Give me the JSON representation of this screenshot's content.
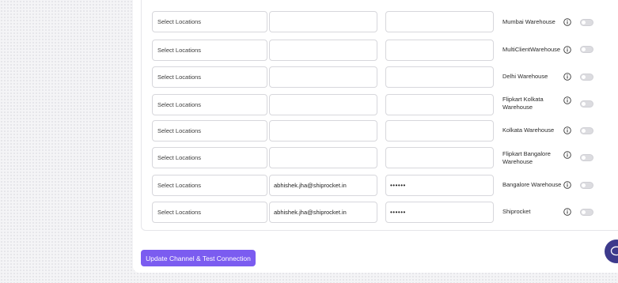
{
  "rows": [
    {
      "location": "Select Locations",
      "email": "",
      "password": "",
      "warehouse": "Mumbai Warehouse"
    },
    {
      "location": "Select Locations",
      "email": "",
      "password": "",
      "warehouse": "MultiClientWarehouse"
    },
    {
      "location": "Select Locations",
      "email": "",
      "password": "",
      "warehouse": "Delhi Warehouse"
    },
    {
      "location": "Select Locations",
      "email": "",
      "password": "",
      "warehouse": "Flipkart Kolkata Warehouse"
    },
    {
      "location": "Select Locations",
      "email": "",
      "password": "",
      "warehouse": "Kolkata Warehouse"
    },
    {
      "location": "Select Locations",
      "email": "",
      "password": "",
      "warehouse": "Flipkart Bangalore Warehouse"
    },
    {
      "location": "Select Locations",
      "email": "abhishek.jha@shiprocket.in",
      "password": "••••••",
      "warehouse": "Bangalore Warehouse"
    },
    {
      "location": "Select Locations",
      "email": "abhishek.jha@shiprocket.in",
      "password": "••••••",
      "warehouse": "Shiprocket"
    }
  ],
  "update_button": "Update Channel & Test Connection",
  "colors": {
    "accent": "#7b5cf0",
    "chat_widget": "#3d3a8c",
    "toggle_off": "#dcdce0"
  },
  "icons": {
    "info": "info-icon",
    "chat": "chat-bubble-icon"
  }
}
